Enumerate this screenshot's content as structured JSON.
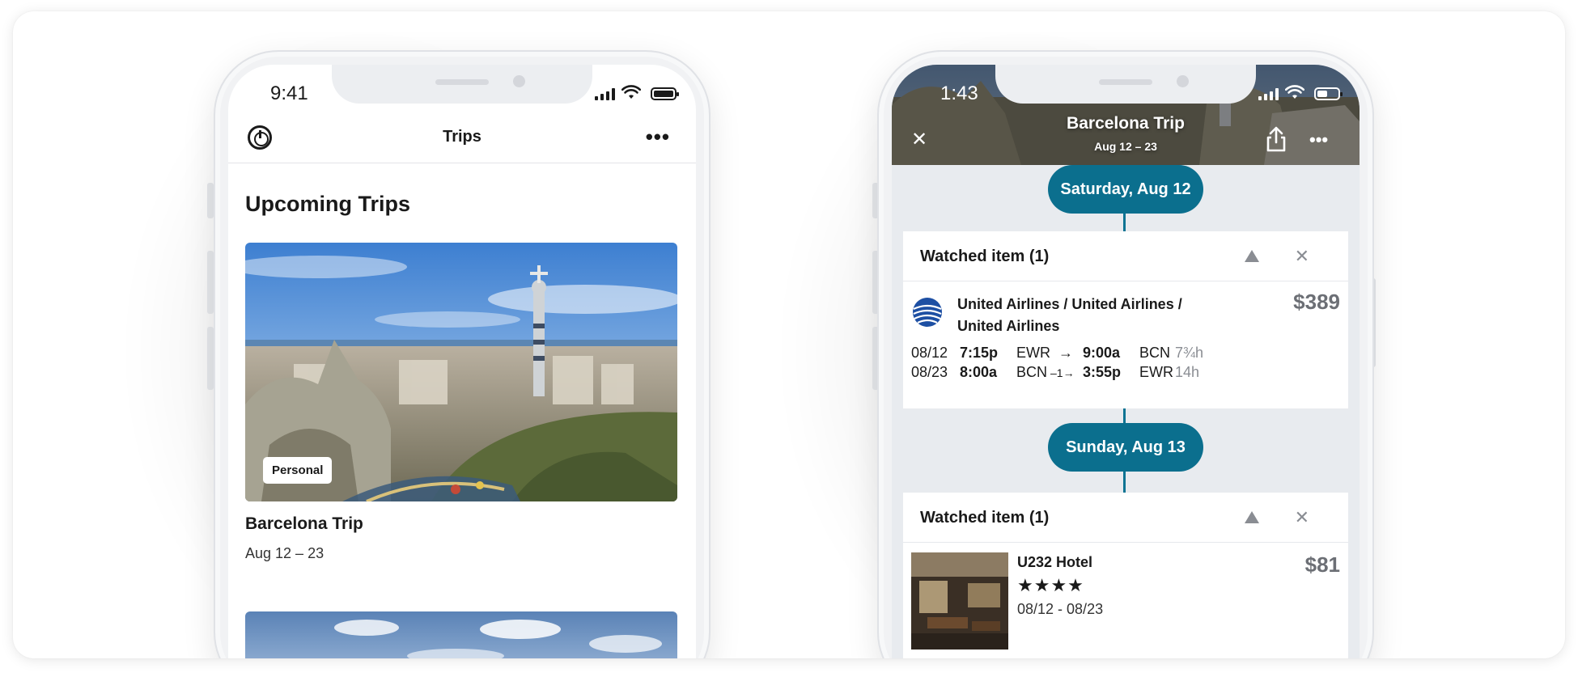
{
  "left_phone": {
    "status": {
      "time": "9:41"
    },
    "header": {
      "title": "Trips",
      "more_label": "•••"
    },
    "section_title": "Upcoming Trips",
    "trips": [
      {
        "name": "Barcelona Trip",
        "dates": "Aug 12 – 23",
        "badge": "Personal"
      }
    ]
  },
  "right_phone": {
    "status": {
      "time": "1:43"
    },
    "header": {
      "title": "Barcelona Trip",
      "subtitle": "Aug 12 – 23",
      "close_label": "✕",
      "more_label": "•••"
    },
    "days": [
      {
        "label": "Saturday, Aug 12",
        "card_title": "Watched item (1)",
        "flight": {
          "airline_line1": "United Airlines / United Airlines /",
          "airline_line2": "United Airlines",
          "price": "$389",
          "legs": [
            {
              "date": "08/12",
              "depart_time": "7:15p",
              "origin": "EWR",
              "arrow": "→",
              "arrive_time": "9:00a",
              "dest": "BCN",
              "duration": "7¾h"
            },
            {
              "date": "08/23",
              "depart_time": "8:00a",
              "origin": "BCN",
              "arrow": "–1→",
              "arrive_time": "3:55p",
              "dest": "EWR",
              "duration": "14h"
            }
          ]
        }
      },
      {
        "label": "Sunday, Aug 13",
        "card_title": "Watched item (1)",
        "hotel": {
          "name": "U232 Hotel",
          "stars": "★★★★",
          "dates": "08/12 - 08/23",
          "price": "$81"
        }
      }
    ]
  },
  "colors": {
    "accent": "#0b6f8e",
    "muted": "#8a8d93",
    "timeline_bg": "#e8ebef"
  },
  "icons": [
    "logo-icon",
    "more-icon",
    "signal-icon",
    "wifi-icon",
    "battery-icon",
    "close-icon",
    "share-icon",
    "collapse-icon",
    "dismiss-icon",
    "united-logo-icon"
  ]
}
